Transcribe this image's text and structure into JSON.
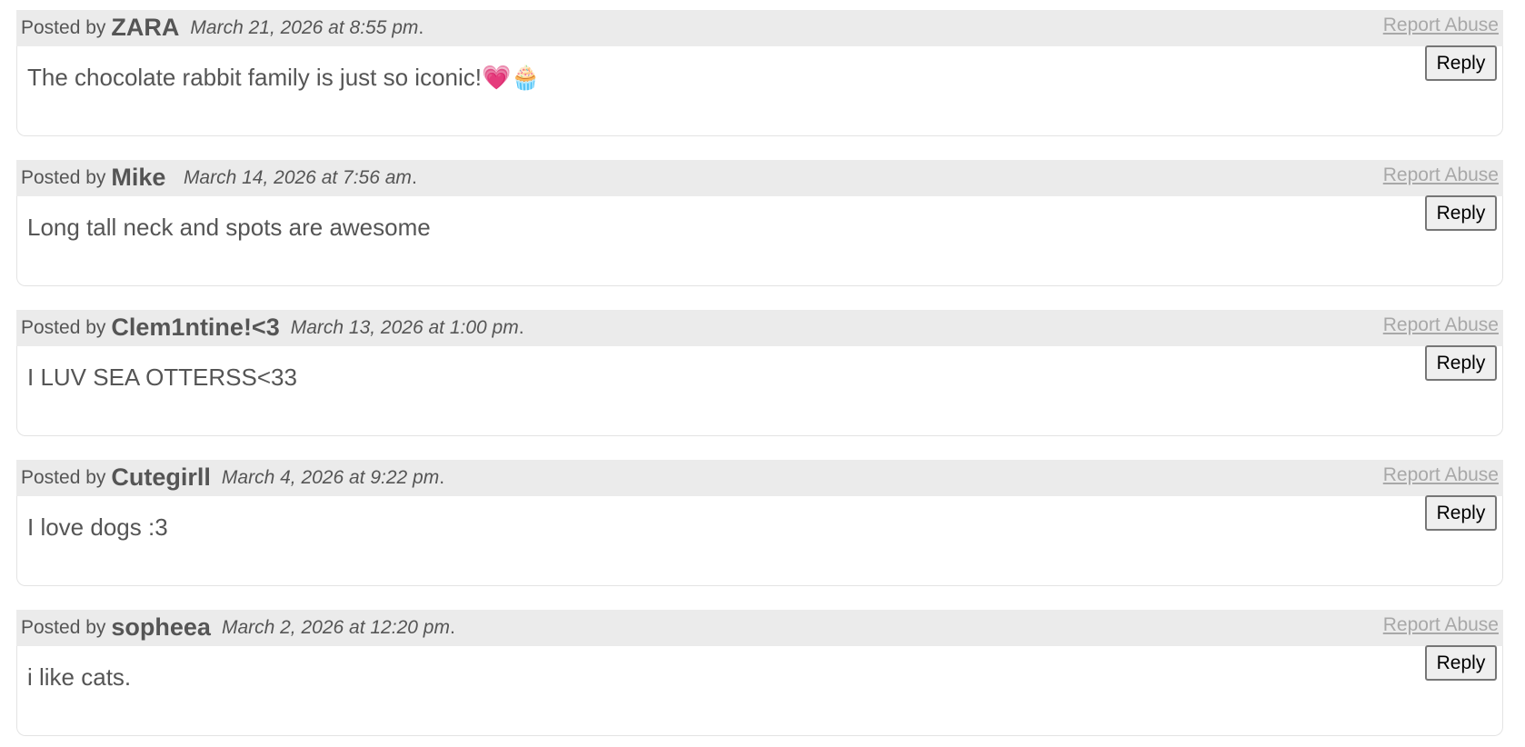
{
  "labels": {
    "posted_by": "Posted by",
    "report_abuse": "Report Abuse",
    "reply": "Reply"
  },
  "comments": [
    {
      "author": "ZARA",
      "date": "March 21, 2026 at 8:55 pm",
      "text": "The chocolate rabbit family is just so iconic!💗🧁"
    },
    {
      "author": "Mike ",
      "date": "March 14, 2026 at 7:56 am",
      "text": "Long tall neck and spots are awesome"
    },
    {
      "author": "Clem1ntine!<3",
      "date": "March 13, 2026 at 1:00 pm",
      "text": "I LUV SEA OTTERSS<33"
    },
    {
      "author": "Cutegirll",
      "date": "March 4, 2026 at 9:22 pm",
      "text": "I love dogs :3"
    },
    {
      "author": "sopheea",
      "date": "March 2, 2026 at 12:20 pm",
      "text": "i like cats."
    }
  ]
}
